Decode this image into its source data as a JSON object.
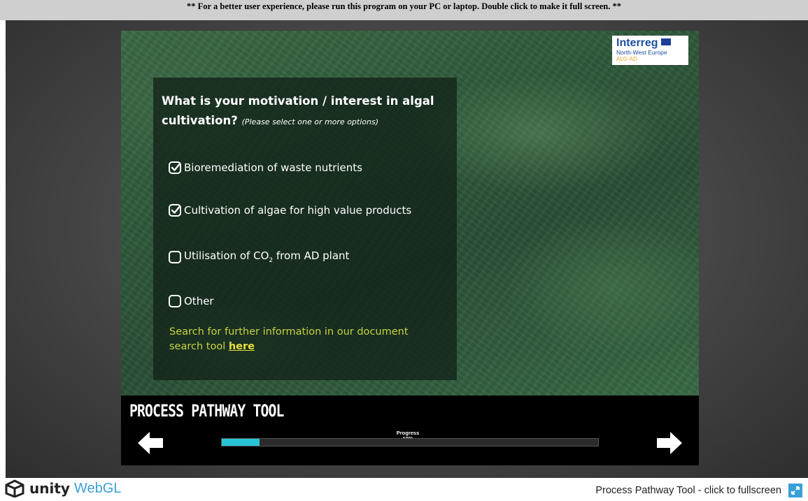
{
  "notice": "** For a better user experience, please run this program on your PC or laptop. Double click to make it full screen. **",
  "logo": {
    "brand": "Interreg",
    "region": "North-West Europe",
    "project": "ALG-AD"
  },
  "question": {
    "title": "What is your motivation / interest in algal cultivation?",
    "hint": "(Please select one or more options)"
  },
  "options": [
    {
      "label": "Bioremediation of waste nutrients",
      "checked": true
    },
    {
      "label": "Cultivation of algae for high value products",
      "checked": true
    },
    {
      "label_before": "Utilisation of CO",
      "label_sub": "2",
      "label_after": " from AD plant",
      "checked": false
    },
    {
      "label": "Other",
      "checked": false
    }
  ],
  "search": {
    "text": "Search for further information in our document search tool ",
    "link": "here"
  },
  "tool_title": "PROCESS PATHWAY TOOL",
  "progress": {
    "label": "Progress",
    "percent_text": "10%",
    "value": 10
  },
  "footer": {
    "unity": "unity",
    "webgl": "WebGL",
    "fullscreen_text": "Process Pathway Tool - click to fullscreen"
  },
  "colors": {
    "progress_fill": "#27c4d6",
    "search_text": "#c5d341",
    "link": "#e8e23a",
    "webgl": "#3aa0d8"
  },
  "icons": [
    "back-arrow-icon",
    "next-arrow-icon",
    "checkmark-icon",
    "unity-logo-icon",
    "fullscreen-icon"
  ]
}
